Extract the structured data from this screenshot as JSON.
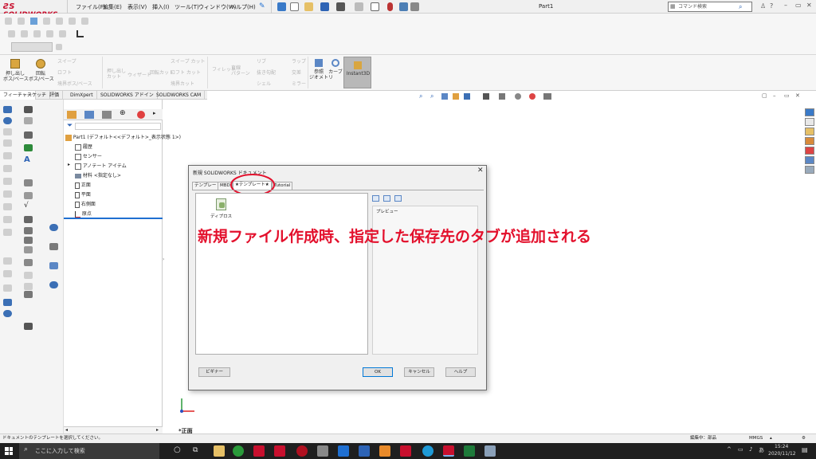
{
  "app": {
    "logo_text": "SOLIDWORKS",
    "doc_title": "Part1",
    "menu": [
      "ファイル(F)",
      "編集(E)",
      "表示(V)",
      "挿入(I)",
      "ツール(T)",
      "ウィンドウ(W)",
      "ヘルプ(H)"
    ],
    "search_placeholder": "コマンド検索",
    "help_label": "?"
  },
  "ribbon": {
    "extrude_boss": "押し出し\nボス/ベース",
    "revolve_boss": "回転\nボス/ベース",
    "sweep_boss": "スイープ",
    "loft_boss": "ロフト",
    "boundary_boss": "境界ボス/ベース",
    "extrude_cut": "押し出し\nカット",
    "hole_wizard": "ウィザード",
    "revolve_cut": "回転カット",
    "sweep_cut": "スイープ カット",
    "loft_cut": "ロフト カット",
    "boundary_cut": "境界カット",
    "fillet": "フィレット",
    "linear_pattern": "直線\nパターン",
    "rib": "リブ",
    "draft": "抜き勾配",
    "shell": "シェル",
    "wrap": "ラップ",
    "intersect": "交差",
    "mirror": "ミラー",
    "ref_geometry": "参照\nジオメトリ",
    "curves": "カーブ",
    "instant3d": "Instant3D"
  },
  "command_tabs": [
    "フィーチャー",
    "スケッチ",
    "評価",
    "DimXpert",
    "SOLIDWORKS アドイン",
    "SOLIDWORKS CAM"
  ],
  "tree": {
    "root": "Part1 (デフォルト<<デフォルト>_表示状態 1>)",
    "items": [
      "履歴",
      "センサー",
      "アノテート アイテム",
      "材料 <指定なし>",
      "正面",
      "平面",
      "右側面",
      "原点"
    ]
  },
  "dialog": {
    "title": "新規 SOLIDWORKS ドキュメント",
    "tabs": [
      "テンプレート",
      "MBD",
      "★テンプレート★",
      "Tutorial"
    ],
    "template_item": "ディプロス",
    "preview_label": "プレビュー",
    "novice_button": "ビギナー",
    "ok_button": "OK",
    "cancel_button": "キャンセル",
    "help_button": "ヘルプ"
  },
  "annotation": "新規ファイル作成時、指定した保存先のタブが追加される",
  "viewport": {
    "view_label": "*正面"
  },
  "statusbar": {
    "message": "ドキュメントのテンプレートを選択してください。",
    "edit_mode": "編集中：部品",
    "units": "MMGS"
  },
  "taskbar": {
    "search_placeholder": "ここに入力して検索",
    "time": "15:24",
    "date": "2020/11/12"
  },
  "colors": {
    "annotation_red": "#e3102c",
    "circle_red": "#e3102c",
    "brand_red": "#c8102e",
    "taskbar_bg": "#1f1f1f"
  }
}
